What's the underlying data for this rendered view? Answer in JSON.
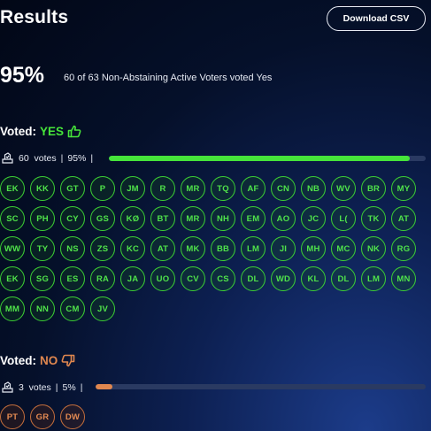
{
  "header": {
    "title": "Results",
    "download_label": "Download CSV"
  },
  "summary": {
    "percent": "95%",
    "text": "60 of 63 Non-Abstaining Active Voters voted Yes"
  },
  "colors": {
    "yes": "#46e43a",
    "no": "#e0874f",
    "track": "#2a3a62"
  },
  "yes": {
    "label": "Voted:",
    "value": "YES",
    "icon": "thumbs-up-icon",
    "count_text": "60  votes",
    "percent_text": "95%",
    "fraction": 0.95,
    "voters": [
      "EK",
      "KK",
      "GT",
      "P",
      "JM",
      "R",
      "MR",
      "TQ",
      "AF",
      "CN",
      "NB",
      "WV",
      "BR",
      "MY",
      "SC",
      "PH",
      "CY",
      "GS",
      "KØ",
      "BT",
      "MR",
      "NH",
      "EM",
      "AO",
      "JC",
      "L(",
      "TK",
      "AT",
      "WW",
      "TY",
      "NS",
      "ZS",
      "KC",
      "AT",
      "MK",
      "BB",
      "LM",
      "JI",
      "MH",
      "MC",
      "NK",
      "RG",
      "EK",
      "SG",
      "ES",
      "RA",
      "JA",
      "UO",
      "CV",
      "CS",
      "DL",
      "WD",
      "KL",
      "DL",
      "LM",
      "MN",
      "MM",
      "NN",
      "CM",
      "JV"
    ]
  },
  "no": {
    "label": "Voted:",
    "value": "NO",
    "icon": "thumbs-down-icon",
    "count_text": "3  votes",
    "percent_text": "5%",
    "fraction": 0.05,
    "voters": [
      "PT",
      "GR",
      "DW"
    ]
  }
}
